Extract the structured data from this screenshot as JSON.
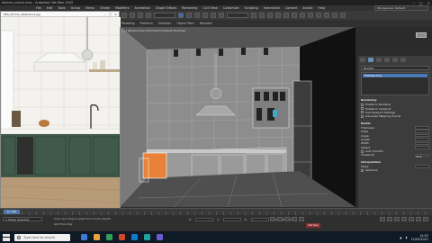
{
  "window": {
    "title": "kitchen_scene.max - Autodesk 3ds Max 2020"
  },
  "menu": {
    "items": [
      "File",
      "Edit",
      "Tools",
      "Group",
      "Views",
      "Create",
      "Modifiers",
      "Animation",
      "Graph Editors",
      "Rendering",
      "Civil View",
      "Customize",
      "Scripting",
      "Interactive",
      "Content",
      "Arnold",
      "Help"
    ],
    "workspace_label": "Workspaces: Default"
  },
  "ribbon": {
    "items": [
      "Modeling",
      "Freeform",
      "Selection",
      "Object Paint",
      "Populate"
    ]
  },
  "photo_window": {
    "title": "IMG_Kitchen_Reference.jpg"
  },
  "viewport": {
    "label": "[+] [Perspective] [Standard] [Default Shading]"
  },
  "command_panel": {
    "name_field": "Box001",
    "selected_item": "Editable Poly",
    "rollout_title": "Rendering",
    "rows": [
      {
        "label": "Enable In Renderer"
      },
      {
        "label": "Enable In Viewport"
      },
      {
        "label": "Use Viewport Settings"
      },
      {
        "label": "Generate Mapping Coords"
      }
    ],
    "sub_title": "Radial",
    "params": [
      "Thickness",
      "Sides",
      "Angle",
      "Length",
      "Width",
      "Aspect"
    ],
    "buttons": [
      "Threshold"
    ],
    "auto_smooth": "Auto Smooth",
    "threshold_value": "40.0",
    "interp_title": "Interpolation",
    "interp_rows": [
      "Steps",
      "Optimize"
    ]
  },
  "timeline": {
    "slider": "0 / 100"
  },
  "status": {
    "selection": "1 Shape Selected",
    "msg1": "Click and drag to select and move objects",
    "msg2": "Add Time Tag",
    "coords": [
      "X:",
      "Y:",
      "Z:"
    ],
    "grid": "Grid = 10.0cm",
    "setkey": "Set Key"
  },
  "taskbar": {
    "search_placeholder": "Type here to search",
    "time": "14:52",
    "date": "12/05/2021",
    "icon_colors": [
      "#3b7bd4",
      "#e8a33a",
      "#2f9e5a",
      "#d24726",
      "#0f7acc",
      "#1fa0a0",
      "#6c5bd6"
    ]
  }
}
